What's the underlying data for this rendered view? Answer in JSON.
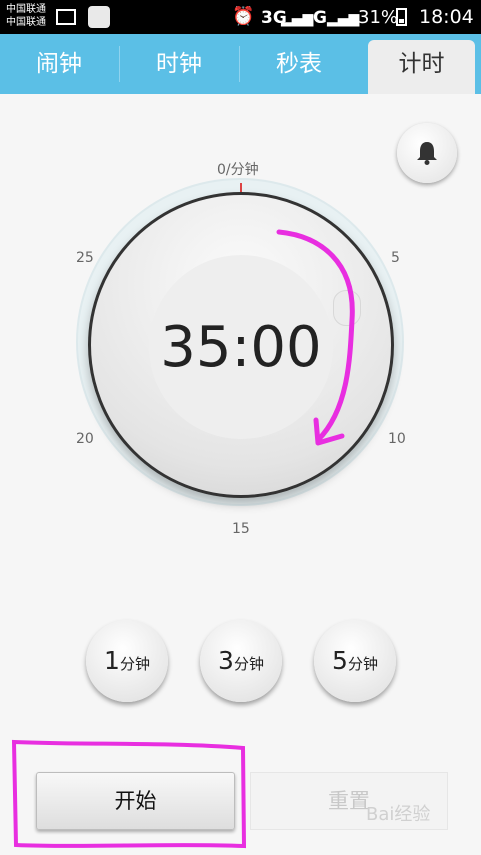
{
  "status_bar": {
    "carrier_line1": "中国联通",
    "carrier_line2": "中国联通",
    "network1": "3G",
    "network2": "G",
    "battery": "31%",
    "time": "18:04"
  },
  "tabs": [
    {
      "label": "闹钟",
      "active": false
    },
    {
      "label": "时钟",
      "active": false
    },
    {
      "label": "秒表",
      "active": false
    },
    {
      "label": "计时",
      "active": true
    }
  ],
  "dial": {
    "top_label": "0/分钟",
    "tick_5": "5",
    "tick_10": "10",
    "tick_15": "15",
    "tick_20": "20",
    "tick_25": "25",
    "display": "35:00"
  },
  "presets": [
    {
      "num": "1",
      "unit": "分钟"
    },
    {
      "num": "3",
      "unit": "分钟"
    },
    {
      "num": "5",
      "unit": "分钟"
    }
  ],
  "buttons": {
    "start": "开始",
    "reset": "重置"
  },
  "watermark": "Bai经验",
  "colors": {
    "tab_bar": "#5bbfe6",
    "annotation": "#e82ee0"
  }
}
